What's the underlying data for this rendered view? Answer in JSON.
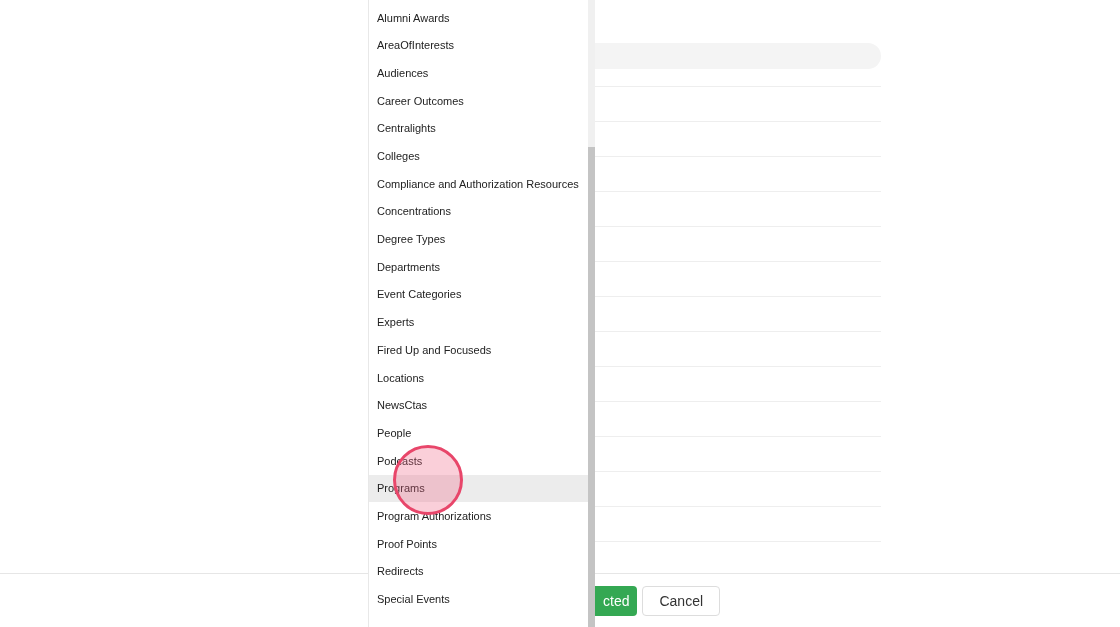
{
  "dropdown": {
    "items": [
      {
        "label": "Alumni Awards",
        "selected": false
      },
      {
        "label": "AreaOfInterests",
        "selected": false
      },
      {
        "label": "Audiences",
        "selected": false
      },
      {
        "label": "Career Outcomes",
        "selected": false
      },
      {
        "label": "Centralights",
        "selected": false
      },
      {
        "label": "Colleges",
        "selected": false
      },
      {
        "label": "Compliance and Authorization Resources",
        "selected": false
      },
      {
        "label": "Concentrations",
        "selected": false
      },
      {
        "label": "Degree Types",
        "selected": false
      },
      {
        "label": "Departments",
        "selected": false
      },
      {
        "label": "Event Categories",
        "selected": false
      },
      {
        "label": "Experts",
        "selected": false
      },
      {
        "label": "Fired Up and Focuseds",
        "selected": false
      },
      {
        "label": "Locations",
        "selected": false
      },
      {
        "label": "NewsCtas",
        "selected": false
      },
      {
        "label": "People",
        "selected": false
      },
      {
        "label": "Podcasts",
        "selected": false
      },
      {
        "label": "Programs",
        "selected": true
      },
      {
        "label": "Program Authorizations",
        "selected": false
      },
      {
        "label": "Proof Points",
        "selected": false
      },
      {
        "label": "Redirects",
        "selected": false
      },
      {
        "label": "Special Events",
        "selected": false
      }
    ]
  },
  "footer": {
    "buttons": [
      {
        "label": "cted",
        "kind": "primary"
      },
      {
        "label": "Cancel",
        "kind": "secondary"
      }
    ]
  }
}
